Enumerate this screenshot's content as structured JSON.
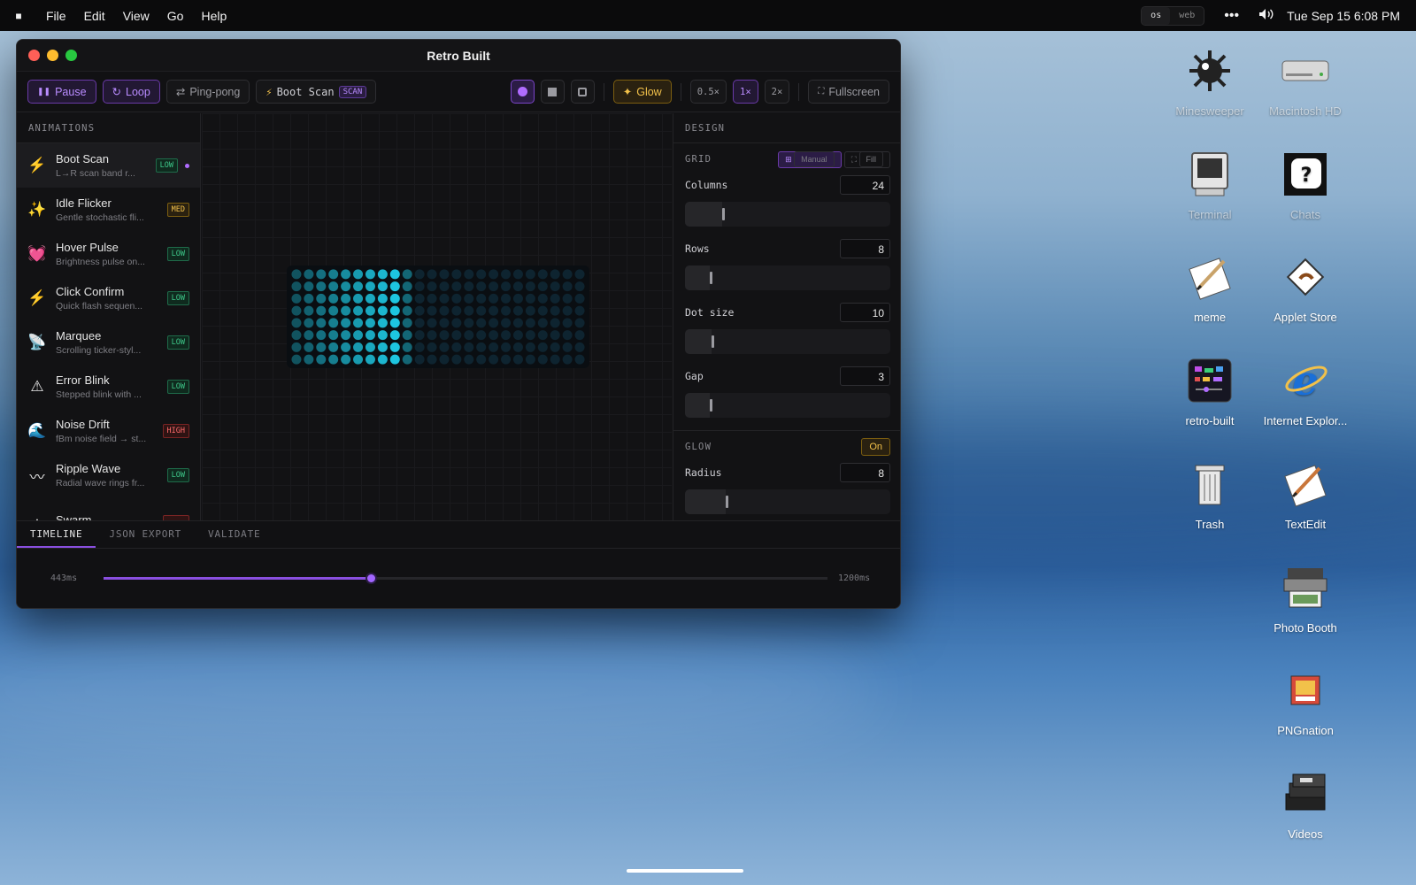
{
  "menubar": {
    "menus": [
      "File",
      "Edit",
      "View",
      "Go",
      "Help"
    ],
    "mode_options": [
      "os",
      "web"
    ],
    "mode_selected": "os",
    "clock": "Tue Sep 15 6:08 PM"
  },
  "window": {
    "title": "Retro Built",
    "toolbar": {
      "pause_label": "Pause",
      "loop_label": "Loop",
      "pingpong_label": "Ping-pong",
      "animation_label": "Boot Scan",
      "animation_tag": "SCAN",
      "glow_label": "Glow",
      "speeds": [
        "0.5×",
        "1×",
        "2×"
      ],
      "speed_selected": "1×",
      "fullscreen_label": "Fullscreen"
    },
    "sidebar": {
      "header": "ANIMATIONS",
      "items": [
        {
          "name": "Boot Scan",
          "desc": "L→R scan band r...",
          "badge": "LOW",
          "level": "low",
          "icon": "lightning-icon",
          "glyph": "⚡",
          "active": true
        },
        {
          "name": "Idle Flicker",
          "desc": "Gentle stochastic fli...",
          "badge": "MED",
          "level": "med",
          "icon": "sparkles-icon",
          "glyph": "✨"
        },
        {
          "name": "Hover Pulse",
          "desc": "Brightness pulse on...",
          "badge": "LOW",
          "level": "low",
          "icon": "heart-icon",
          "glyph": "💓"
        },
        {
          "name": "Click Confirm",
          "desc": "Quick flash sequen...",
          "badge": "LOW",
          "level": "low",
          "icon": "lightning-icon",
          "glyph": "⚡"
        },
        {
          "name": "Marquee",
          "desc": "Scrolling ticker-styl...",
          "badge": "LOW",
          "level": "low",
          "icon": "satellite-icon",
          "glyph": "📡"
        },
        {
          "name": "Error Blink",
          "desc": "Stepped blink with ...",
          "badge": "LOW",
          "level": "low",
          "icon": "warning-icon",
          "glyph": "⚠"
        },
        {
          "name": "Noise Drift",
          "desc": "fBm noise field → st...",
          "badge": "HIGH",
          "level": "high",
          "icon": "wave-icon",
          "glyph": "🌊"
        },
        {
          "name": "Ripple Wave",
          "desc": "Radial wave rings fr...",
          "badge": "LOW",
          "level": "low",
          "icon": "ripple-icon",
          "glyph": "〰"
        },
        {
          "name": "Swarm",
          "desc": "",
          "badge": "",
          "level": "high",
          "icon": "swarm-icon",
          "glyph": "·"
        }
      ]
    },
    "matrix": {
      "columns": 24,
      "rows": 8,
      "lit_columns": 10,
      "color": "#1fd3f0"
    },
    "design": {
      "header": "DESIGN",
      "grid": {
        "label": "GRID",
        "modes": [
          "Manual",
          "Fill"
        ],
        "mode_selected": "Manual",
        "controls": [
          {
            "label": "Columns",
            "value": "24",
            "fraction": 0.18
          },
          {
            "label": "Rows",
            "value": "8",
            "fraction": 0.12
          },
          {
            "label": "Dot size",
            "value": "10",
            "fraction": 0.13
          },
          {
            "label": "Gap",
            "value": "3",
            "fraction": 0.12
          }
        ]
      },
      "glow": {
        "label": "GLOW",
        "state": "On",
        "controls": [
          {
            "label": "Radius",
            "value": "8",
            "fraction": 0.2
          }
        ]
      }
    },
    "bottom": {
      "tabs": [
        "TIMELINE",
        "JSON EXPORT",
        "VALIDATE"
      ],
      "tab_selected": "TIMELINE",
      "timeline": {
        "current": "443ms",
        "total": "1200ms",
        "progress": 0.369
      }
    }
  },
  "desktop_icons": [
    {
      "label": "Minesweeper",
      "icon": "minesweeper-icon",
      "faded": true
    },
    {
      "label": "Macintosh HD",
      "icon": "hard-drive-icon",
      "faded": true
    },
    {
      "label": "Terminal",
      "icon": "terminal-icon",
      "faded": true
    },
    {
      "label": "Chats",
      "icon": "chats-icon",
      "faded": true
    },
    {
      "label": "meme",
      "icon": "textedit-doc-icon"
    },
    {
      "label": "Applet Store",
      "icon": "applet-store-icon"
    },
    {
      "label": "retro-built",
      "icon": "retro-built-icon"
    },
    {
      "label": "Internet Explor...",
      "icon": "internet-explorer-icon"
    },
    {
      "label": "Trash",
      "icon": "trash-icon"
    },
    {
      "label": "TextEdit",
      "icon": "textedit-icon"
    },
    {
      "label": "Photo Booth",
      "icon": "photo-booth-icon"
    },
    {
      "label": "PNGnation",
      "icon": "pngnation-icon"
    },
    {
      "label": "Videos",
      "icon": "videos-icon"
    }
  ]
}
